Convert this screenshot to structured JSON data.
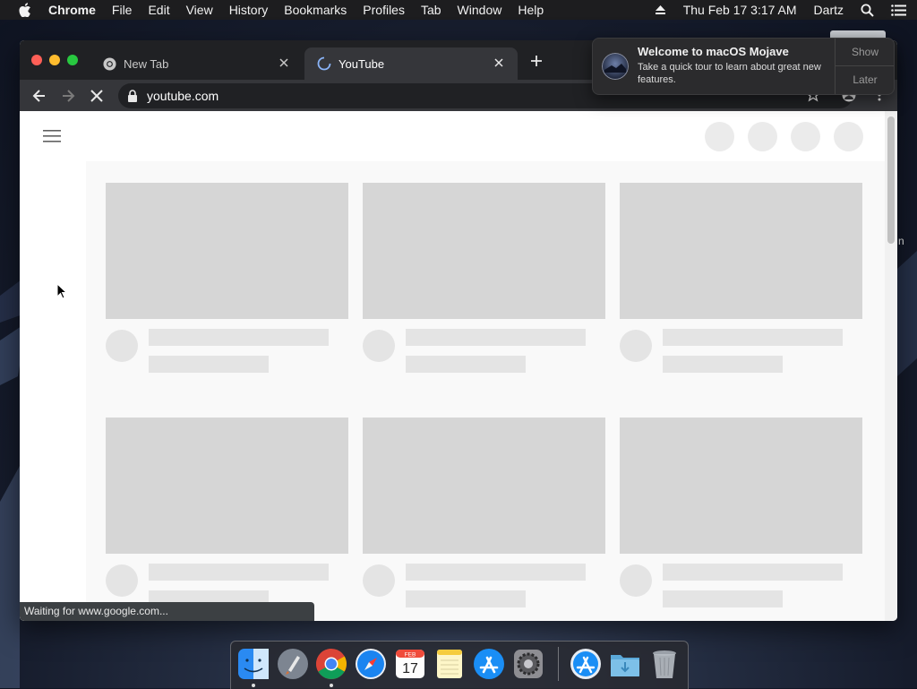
{
  "menubar": {
    "app_name": "Chrome",
    "menus": [
      "File",
      "Edit",
      "View",
      "History",
      "Bookmarks",
      "Profiles",
      "Tab",
      "Window",
      "Help"
    ],
    "clock": "Thu Feb 17  3:17 AM",
    "user": "Dartz"
  },
  "browser": {
    "tabs": [
      {
        "title": "New Tab",
        "active": false
      },
      {
        "title": "YouTube",
        "active": true
      }
    ],
    "url": "youtube.com",
    "status_text": "Waiting for www.google.com..."
  },
  "notification": {
    "title": "Welcome to macOS Mojave",
    "body": "Take a quick tour to learn about great new features.",
    "show_label": "Show",
    "later_label": "Later"
  },
  "desktop": {
    "partial_label": "n"
  },
  "dock": {
    "items": [
      "finder-icon",
      "launchpad-icon",
      "chrome-icon",
      "safari-icon",
      "calendar-icon",
      "notes-icon",
      "app-store-icon",
      "system-preferences-icon",
      "app-store-downloads-icon",
      "downloads-folder-icon",
      "trash-icon"
    ],
    "calendar_month": "FEB",
    "calendar_day": "17"
  },
  "colors": {
    "menubar": "#1d1d1f",
    "tabbar": "#202124",
    "toolbar": "#35363a",
    "placeholder": "#d6d6d6"
  }
}
